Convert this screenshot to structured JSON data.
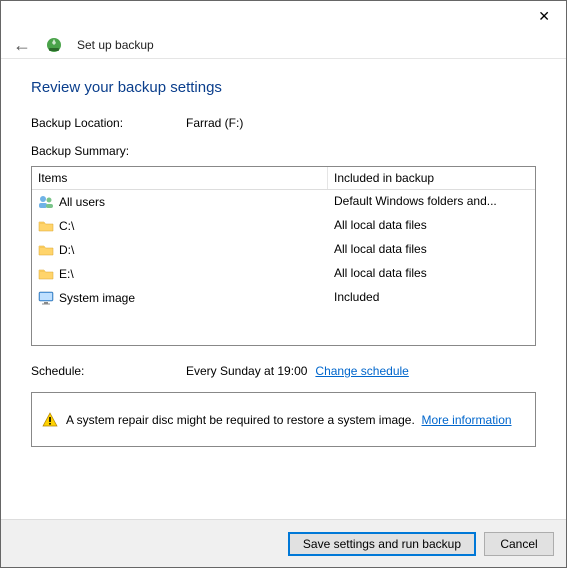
{
  "titlebar": {
    "close": "✕"
  },
  "nav": {
    "title": "Set up backup"
  },
  "heading": "Review your backup settings",
  "location": {
    "label": "Backup Location:",
    "value": "Farrad (F:)"
  },
  "summary": {
    "label": "Backup Summary:",
    "columns": {
      "a": "Items",
      "b": "Included in backup"
    },
    "rows": [
      {
        "icon": "users-icon",
        "item": "All users",
        "included": "Default Windows folders and..."
      },
      {
        "icon": "folder-icon",
        "item": "C:\\",
        "included": "All local data files"
      },
      {
        "icon": "folder-icon",
        "item": "D:\\",
        "included": "All local data files"
      },
      {
        "icon": "folder-icon",
        "item": "E:\\",
        "included": "All local data files"
      },
      {
        "icon": "monitor-icon",
        "item": "System image",
        "included": "Included"
      }
    ]
  },
  "schedule": {
    "label": "Schedule:",
    "value": "Every Sunday at 19:00",
    "link": "Change schedule"
  },
  "info": {
    "text": "A system repair disc might be required to restore a system image.",
    "link": "More information"
  },
  "footer": {
    "primary": "Save settings and run backup",
    "cancel": "Cancel"
  }
}
